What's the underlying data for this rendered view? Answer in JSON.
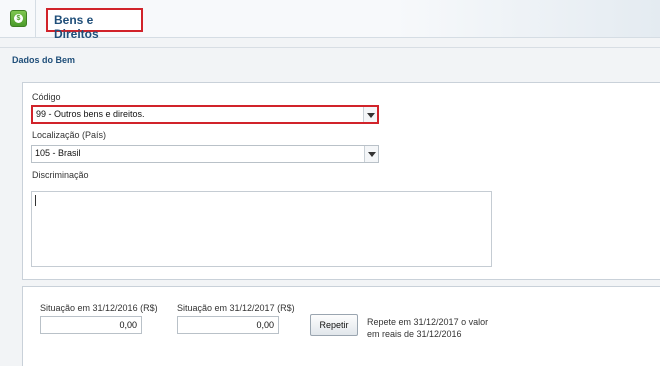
{
  "header": {
    "title": "Bens e Direitos",
    "icon": "money-bag-icon"
  },
  "section": {
    "title": "Dados do Bem"
  },
  "form": {
    "codigo": {
      "label": "Código",
      "value": "99 - Outros bens e direitos."
    },
    "localizacao": {
      "label": "Localização (País)",
      "value": "105 - Brasil"
    },
    "discriminacao": {
      "label": "Discriminação",
      "value": ""
    }
  },
  "situacao": {
    "s2016": {
      "label": "Situação em 31/12/2016 (R$)",
      "value": "0,00"
    },
    "s2017": {
      "label": "Situação em 31/12/2017 (R$)",
      "value": "0,00"
    },
    "repetir_label": "Repetir",
    "repetir_note_line1": "Repete em 31/12/2017 o valor",
    "repetir_note_line2": "em reais de 31/12/2016"
  },
  "colors": {
    "highlight": "#d1232a",
    "title": "#1f4e79"
  }
}
